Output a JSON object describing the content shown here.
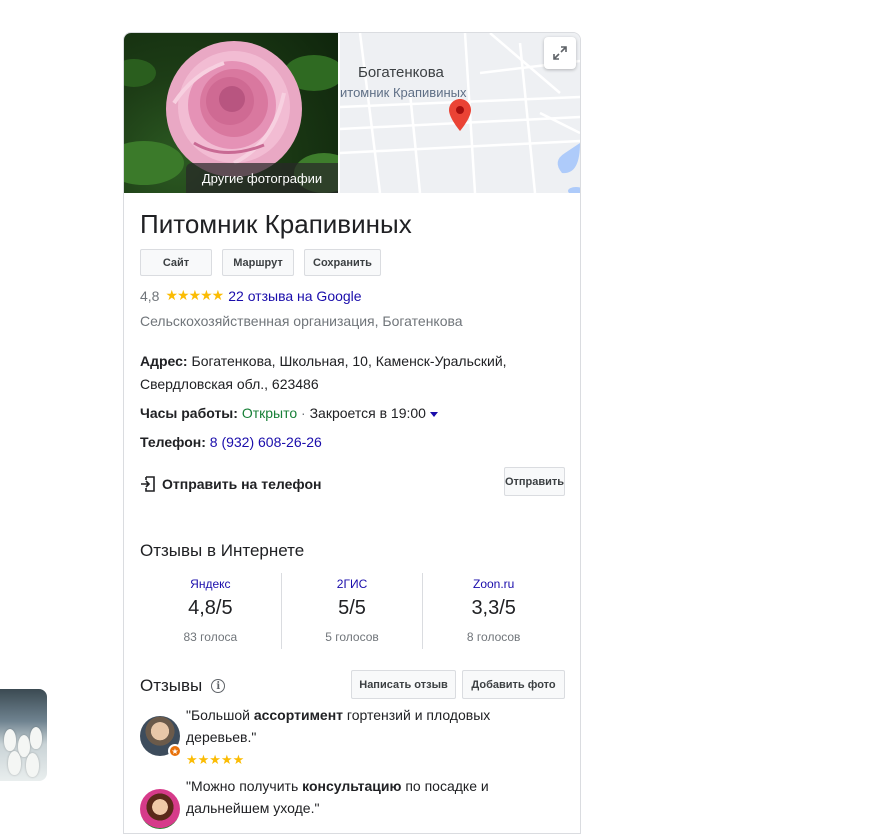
{
  "photo": {
    "more_photos_label": "Другие фотографии"
  },
  "map": {
    "village_label": "Богатенкова",
    "poi_label": "итомник Крапивиных"
  },
  "place": {
    "name": "Питомник Крапивиных",
    "actions": {
      "site": "Сайт",
      "route": "Маршрут",
      "save": "Сохранить"
    },
    "rating": {
      "value": "4,8",
      "stars": "★★★★★",
      "reviews_link": "22 отзыва на Google"
    },
    "category": "Сельскохозяйственная организация, Богатенкова",
    "address": {
      "label": "Адрес:",
      "line1": "Богатенкова, Школьная, 10, Каменск-Уральский,",
      "line2": "Свердловская обл., 623486"
    },
    "hours": {
      "label": "Часы работы:",
      "status": "Открыто",
      "separator": "·",
      "closes": "Закроется в 19:00"
    },
    "phone": {
      "label": "Телефон:",
      "value": "8 (932) 608-26-26"
    },
    "send_to_phone": {
      "label": "Отправить на телефон",
      "button": "Отправить"
    }
  },
  "web_reviews": {
    "title": "Отзывы в Интернете",
    "sites": [
      {
        "name": "Яндекс",
        "score": "4,8/5",
        "votes": "83 голоса"
      },
      {
        "name": "2ГИС",
        "score": "5/5",
        "votes": "5 голосов"
      },
      {
        "name": "Zoon.ru",
        "score": "3,3/5",
        "votes": "8 голосов"
      }
    ]
  },
  "reviews": {
    "title": "Отзывы",
    "write_button": "Написать отзыв",
    "add_photo_button": "Добавить фото",
    "items": [
      {
        "before": "\"Большой ",
        "bold": "ассортимент",
        "after": " гортензий и плодовых деревьев.\"",
        "stars": "★★★★★"
      },
      {
        "before": "\"Можно получить ",
        "bold": "консультацию",
        "after": " по посадке и дальнейшем уходе.\"",
        "stars": ""
      }
    ]
  },
  "colors": {
    "link": "#1a0dab",
    "open": "#188038",
    "star": "#fbbc04",
    "pin": "#ea4335"
  }
}
